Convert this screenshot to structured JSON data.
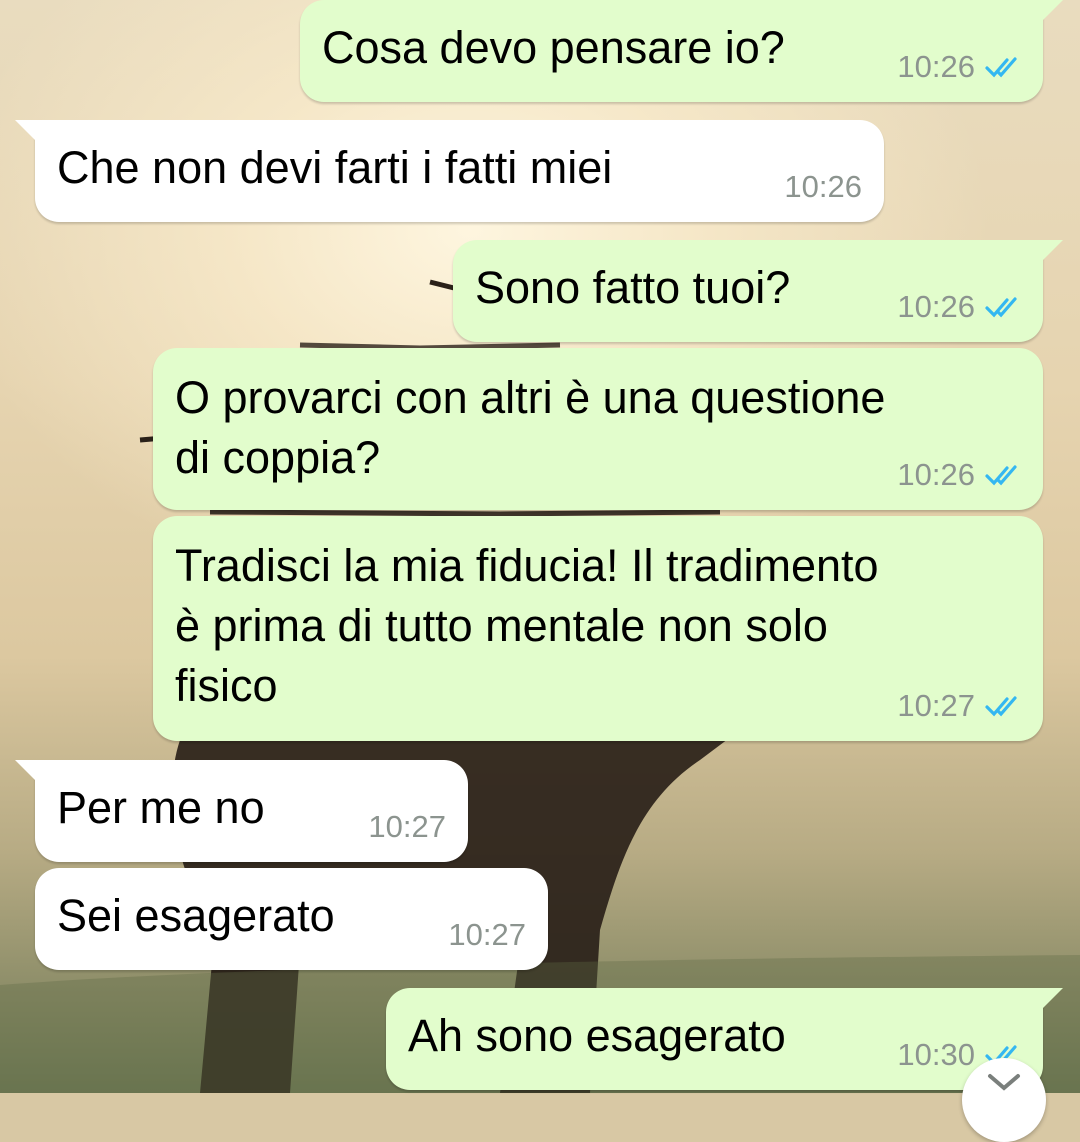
{
  "chat": {
    "messages": [
      {
        "direction": "outgoing",
        "text": "Cosa devo pensare io?",
        "time": "10:26",
        "status": "read"
      },
      {
        "direction": "incoming",
        "text": "Che non devi farti i fatti miei",
        "time": "10:26"
      },
      {
        "direction": "outgoing",
        "text": "Sono fatto tuoi?",
        "time": "10:26",
        "status": "read"
      },
      {
        "direction": "outgoing",
        "text": "O provarci con altri è una questione\ndi coppia?",
        "time": "10:26",
        "status": "read"
      },
      {
        "direction": "outgoing",
        "text": "Tradisci la mia fiducia! Il tradimento\nè prima di tutto mentale non solo\nfisico",
        "time": "10:27",
        "status": "read"
      },
      {
        "direction": "incoming",
        "text": "Per me no",
        "time": "10:27"
      },
      {
        "direction": "incoming",
        "text": "Sei esagerato",
        "time": "10:27"
      },
      {
        "direction": "outgoing",
        "text": "Ah sono esagerato",
        "time": "10:30",
        "status": "read"
      }
    ]
  },
  "colors": {
    "outgoing_bubble": "#e2fdcc",
    "incoming_bubble": "#ffffff",
    "read_ticks": "#34b7f1",
    "timestamp": "#8c948f"
  },
  "icons": {
    "read_receipt": "double-check-icon",
    "scroll_down": "chevron-down-icon"
  }
}
